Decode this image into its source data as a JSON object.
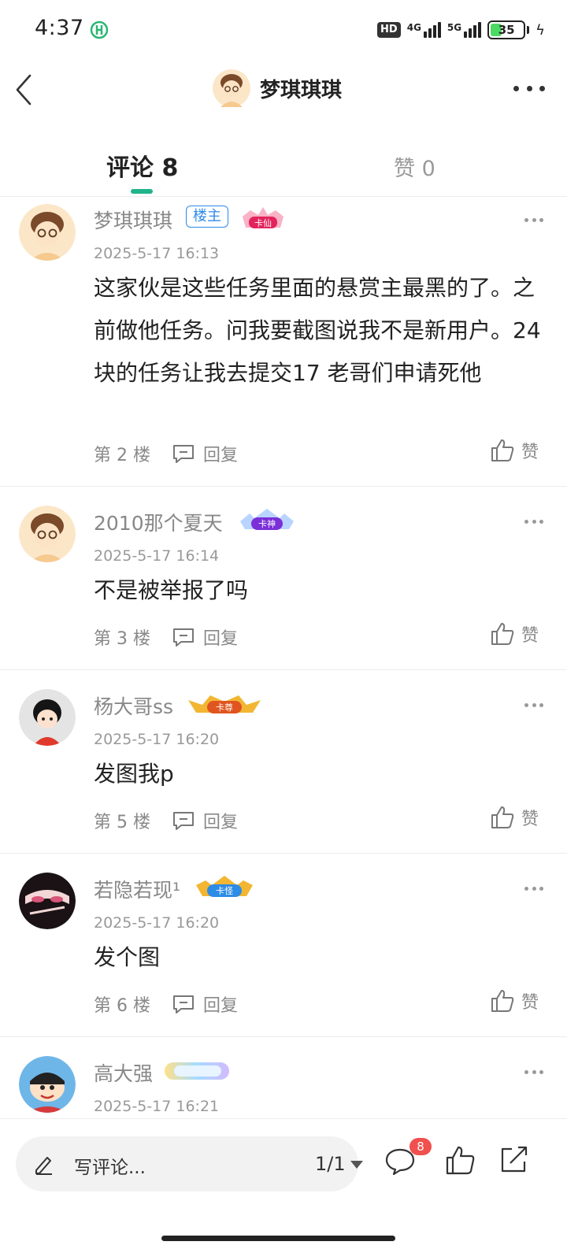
{
  "status": {
    "time": "4:37",
    "hd": "HD",
    "net1": "4G",
    "net2": "5G",
    "battery": "35",
    "battery_level": 0.35
  },
  "header": {
    "title": "梦琪琪琪"
  },
  "tabs": [
    {
      "label": "评论 8"
    },
    {
      "label": "赞 0"
    }
  ],
  "comments": [
    {
      "name": "梦琪琪琪",
      "owner_badge": "楼主",
      "medal": "卡仙",
      "time": "2025-5-17 16:13",
      "text": "这家伙是这些任务里面的悬赏主最黑的了。之前做他任务。问我要截图说我不是新用户。24块的任务让我去提交17 老哥们申请死他",
      "floor": "第 2 楼",
      "reply": "回复",
      "like": "赞"
    },
    {
      "name": "2010那个夏天",
      "medal": "卡神",
      "time": "2025-5-17 16:14",
      "text": "不是被举报了吗",
      "floor": "第 3 楼",
      "reply": "回复",
      "like": "赞"
    },
    {
      "name": "杨大哥ss",
      "medal": "卡尊",
      "time": "2025-5-17 16:20",
      "text": "发图我p",
      "floor": "第 5 楼",
      "reply": "回复",
      "like": "赞"
    },
    {
      "name": "若隐若现¹",
      "medal": "卡怪",
      "time": "2025-5-17 16:20",
      "text": "发个图",
      "floor": "第 6 楼",
      "reply": "回复",
      "like": "赞"
    },
    {
      "name": "高大强",
      "time": "2025-5-17 16:21"
    }
  ],
  "bottom": {
    "placeholder": "写评论...",
    "page": "1/1",
    "comment_count": "8"
  },
  "colors": {
    "accent": "#21b48a",
    "owner_badge": "#2f8be8",
    "notify": "#f0504e"
  }
}
